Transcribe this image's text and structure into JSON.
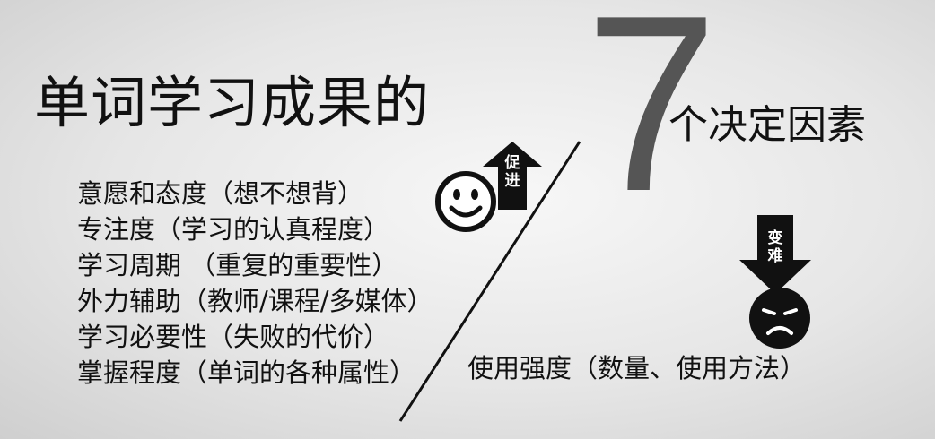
{
  "title": {
    "left": "单词学习成果的",
    "number": "7",
    "right": "个决定因素"
  },
  "factors_left": [
    "意愿和态度（想不想背）",
    "专注度（学习的认真程度）",
    "学习周期 （重复的重要性）",
    "外力辅助（教师/课程/多媒体）",
    "学习必要性（失败的代价）",
    "掌握程度（单词的各种属性）"
  ],
  "factor_right": "使用强度（数量、使用方法）",
  "badges": {
    "promote": "促进",
    "harder": "变难"
  },
  "colors": {
    "seven": "#555555",
    "text": "#111111",
    "icon": "#111111",
    "background": "#e8e8e8"
  }
}
